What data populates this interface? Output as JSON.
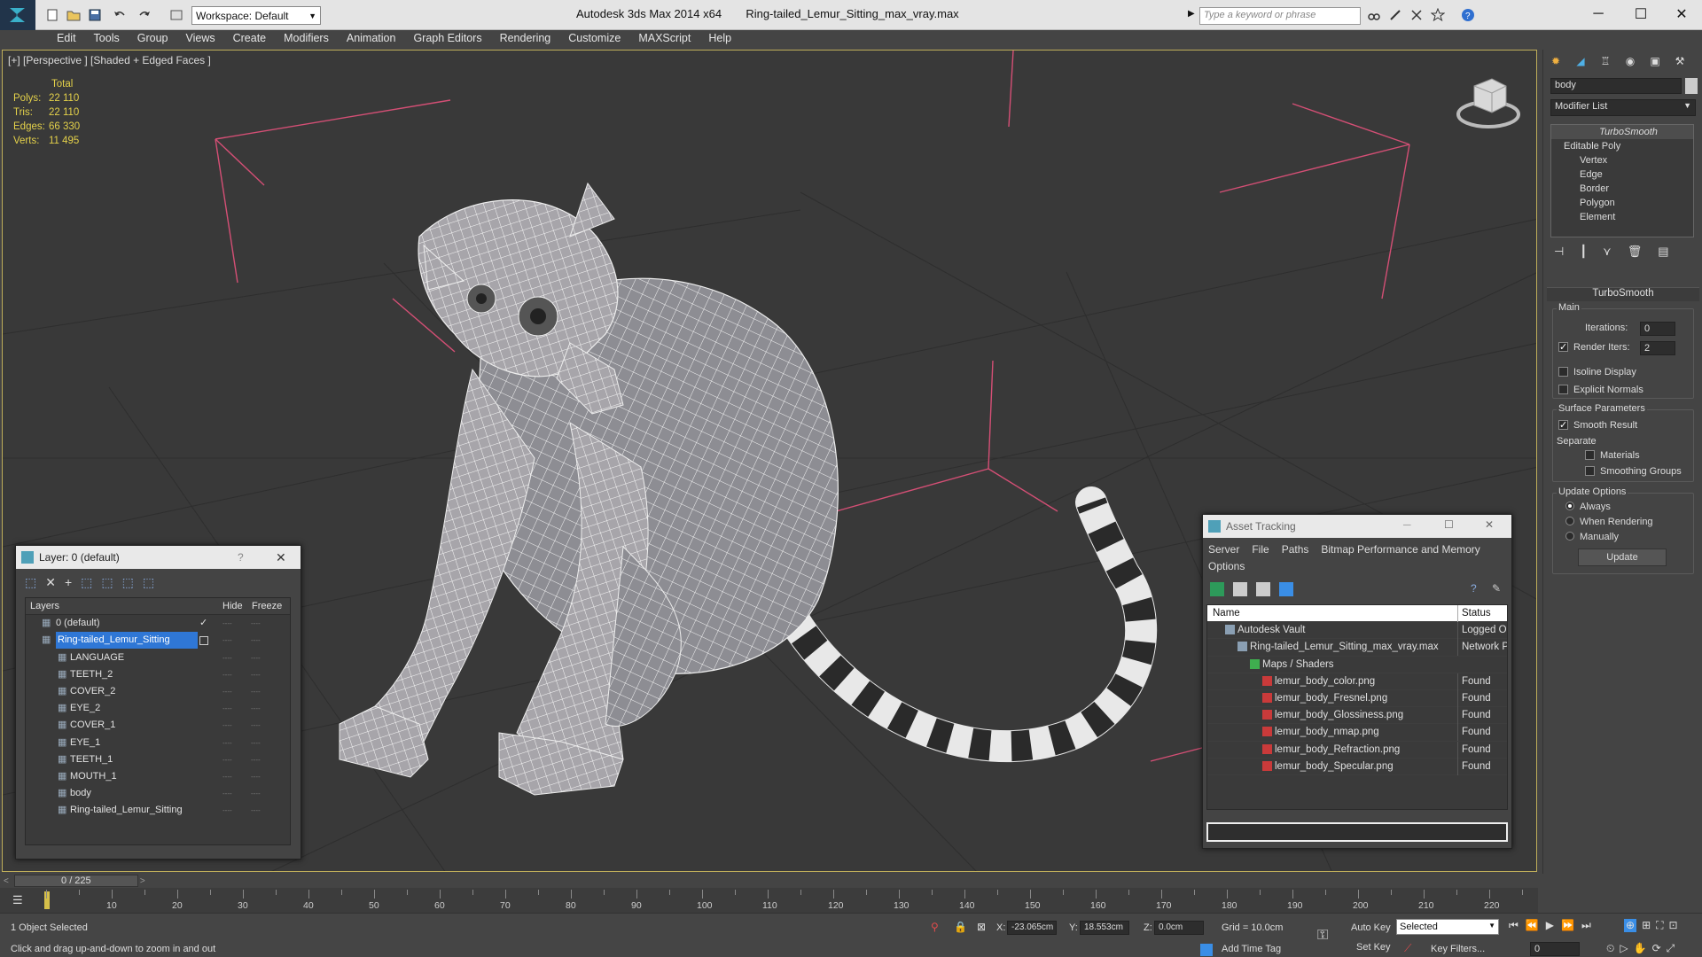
{
  "app": {
    "title": "Autodesk 3ds Max  2014 x64",
    "file": "Ring-tailed_Lemur_Sitting_max_vray.max",
    "workspace": "Workspace: Default",
    "search_placeholder": "Type a keyword or phrase"
  },
  "menu": [
    "Edit",
    "Tools",
    "Group",
    "Views",
    "Create",
    "Modifiers",
    "Animation",
    "Graph Editors",
    "Rendering",
    "Customize",
    "MAXScript",
    "Help"
  ],
  "viewport": {
    "label": "[+] [Perspective ] [Shaded + Edged Faces ]",
    "stats": {
      "header": "Total",
      "rows": [
        {
          "k": "Polys:",
          "v": "22 110"
        },
        {
          "k": "Tris:",
          "v": "22 110"
        },
        {
          "k": "Edges:",
          "v": "66 330"
        },
        {
          "k": "Verts:",
          "v": "11 495"
        }
      ]
    }
  },
  "command_panel": {
    "object_name": "body",
    "modifier_list": "Modifier List",
    "stack": [
      {
        "label": "TurboSmooth",
        "italic": true
      },
      {
        "label": "Editable Poly"
      },
      {
        "label": "Vertex"
      },
      {
        "label": "Edge"
      },
      {
        "label": "Border"
      },
      {
        "label": "Polygon"
      },
      {
        "label": "Element"
      }
    ],
    "rollout_title": "TurboSmooth",
    "main_label": "Main",
    "iterations_label": "Iterations:",
    "iterations_value": "0",
    "render_iters_label": "Render Iters:",
    "render_iters_value": "2",
    "isoline_label": "Isoline Display",
    "explicit_normals_label": "Explicit Normals",
    "surface_params_label": "Surface Parameters",
    "smooth_result_label": "Smooth Result",
    "separate_label": "Separate",
    "materials_label": "Materials",
    "smoothing_groups_label": "Smoothing Groups",
    "update_options_label": "Update Options",
    "always_label": "Always",
    "when_rendering_label": "When Rendering",
    "manually_label": "Manually",
    "update_button": "Update"
  },
  "layer_window": {
    "title": "Layer: 0 (default)",
    "help": "?",
    "col_layers": "Layers",
    "col_hide": "Hide",
    "col_freeze": "Freeze",
    "rows": [
      {
        "name": "0 (default)",
        "indent": 0,
        "checked": true
      },
      {
        "name": "Ring-tailed_Lemur_Sitting",
        "indent": 0,
        "selected": true
      },
      {
        "name": "LANGUAGE",
        "indent": 1
      },
      {
        "name": "TEETH_2",
        "indent": 1
      },
      {
        "name": "COVER_2",
        "indent": 1
      },
      {
        "name": "EYE_2",
        "indent": 1
      },
      {
        "name": "COVER_1",
        "indent": 1
      },
      {
        "name": "EYE_1",
        "indent": 1
      },
      {
        "name": "TEETH_1",
        "indent": 1
      },
      {
        "name": "MOUTH_1",
        "indent": 1
      },
      {
        "name": "body",
        "indent": 1
      },
      {
        "name": "Ring-tailed_Lemur_Sitting",
        "indent": 1
      }
    ]
  },
  "asset_window": {
    "title": "Asset Tracking",
    "menus": [
      "Server",
      "File",
      "Paths",
      "Bitmap Performance and Memory"
    ],
    "menu_options": "Options",
    "col_name": "Name",
    "col_status": "Status",
    "rows": [
      {
        "name": "Autodesk Vault",
        "status": "Logged Ou",
        "indent": 1
      },
      {
        "name": "Ring-tailed_Lemur_Sitting_max_vray.max",
        "status": "Network P",
        "indent": 2
      },
      {
        "name": "Maps / Shaders",
        "status": "",
        "indent": 3
      },
      {
        "name": "lemur_body_color.png",
        "status": "Found",
        "indent": 4
      },
      {
        "name": "lemur_body_Fresnel.png",
        "status": "Found",
        "indent": 4
      },
      {
        "name": "lemur_body_Glossiness.png",
        "status": "Found",
        "indent": 4
      },
      {
        "name": "lemur_body_nmap.png",
        "status": "Found",
        "indent": 4
      },
      {
        "name": "lemur_body_Refraction.png",
        "status": "Found",
        "indent": 4
      },
      {
        "name": "lemur_body_Specular.png",
        "status": "Found",
        "indent": 4
      }
    ]
  },
  "timeline": {
    "frame": "0 / 225",
    "ticks": [
      "10",
      "20",
      "30",
      "40",
      "50",
      "60",
      "70",
      "80",
      "90",
      "100",
      "110",
      "120",
      "130",
      "140",
      "150",
      "160",
      "170",
      "180",
      "190",
      "200",
      "210",
      "220"
    ]
  },
  "status": {
    "selection": "1 Object Selected",
    "prompt": "Click and drag up-and-down to zoom in and out",
    "x_label": "X:",
    "x_value": "-23.065cm",
    "y_label": "Y:",
    "y_value": "18.553cm",
    "z_label": "Z:",
    "z_value": "0.0cm",
    "grid": "Grid = 10.0cm",
    "add_time_tag": "Add Time Tag",
    "auto_key": "Auto Key",
    "set_key": "Set Key",
    "selected_dropdown": "Selected",
    "key_filters": "Key Filters...",
    "frame_field": "0"
  },
  "colors": {
    "accent": "#3a8ee6",
    "stats_yellow": "#e4d14a",
    "viewport_border": "#bfae5a",
    "layer_select": "#2f77d6",
    "gizmo_red": "#d44f75"
  }
}
